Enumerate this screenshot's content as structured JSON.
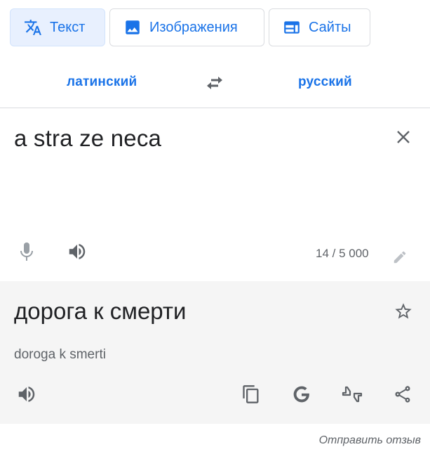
{
  "tabs": [
    {
      "label": "Текст",
      "icon": "translate-icon",
      "active": true
    },
    {
      "label": "Изображения",
      "icon": "image-icon",
      "active": false
    },
    {
      "label": "Сайты",
      "icon": "website-icon",
      "active": false
    }
  ],
  "languages": {
    "source": "латинский",
    "target": "русский",
    "swap_icon": "swap-arrows-icon"
  },
  "source": {
    "text": "a stra ze neca",
    "char_count": "14 / 5 000",
    "clear_icon": "close-icon",
    "mic_icon": "mic-icon",
    "listen_icon": "speaker-icon",
    "edit_icon": "pencil-icon"
  },
  "target": {
    "text": "дорога к смерти",
    "transliteration": "doroga k smerti",
    "star_icon": "star-outline-icon",
    "listen_icon": "speaker-icon",
    "actions": [
      "copy-icon",
      "google-icon",
      "rate-translation-icon",
      "share-icon"
    ]
  },
  "feedback": "Отправить отзыв",
  "colors": {
    "accent": "#1a73e8",
    "active_tab_bg": "#e8f0fe",
    "icon_gray": "#5f6368",
    "disabled_gray": "#9aa0a6",
    "target_bg": "#f5f5f5",
    "text": "#202124"
  }
}
